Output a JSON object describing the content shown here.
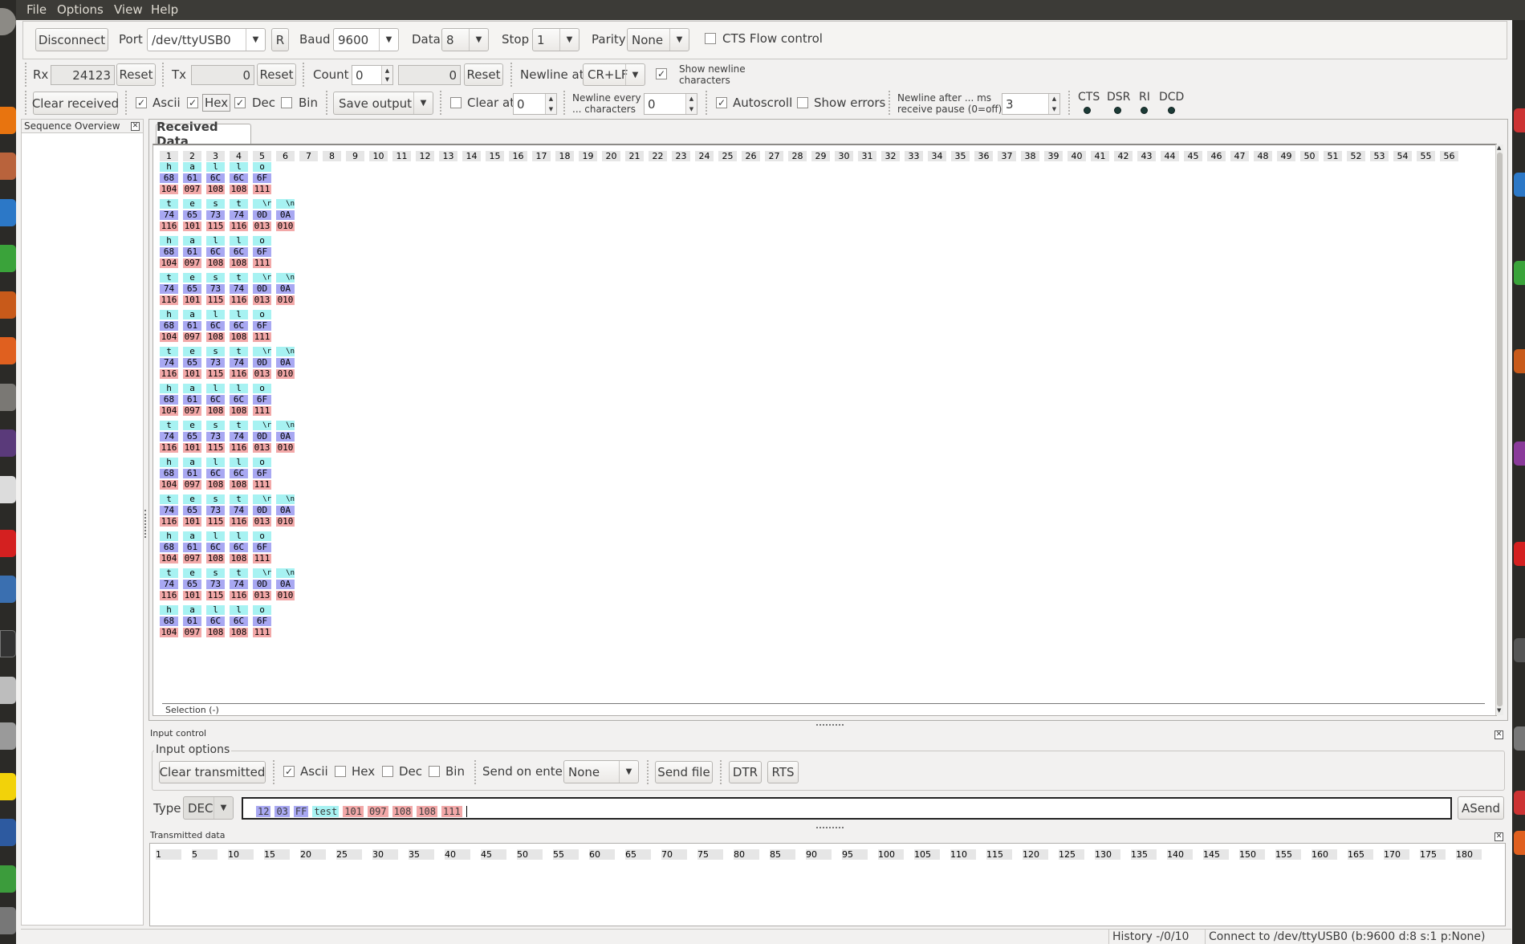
{
  "menu": [
    "File",
    "Options",
    "View",
    "Help"
  ],
  "connection": {
    "disconnect": "Disconnect",
    "port_label": "Port",
    "port_value": "/dev/ttyUSB0",
    "r_button": "R",
    "baud_label": "Baud",
    "baud_value": "9600",
    "data_label": "Data",
    "data_value": "8",
    "stop_label": "Stop",
    "stop_value": "1",
    "parity_label": "Parity",
    "parity_value": "None",
    "cts_flow": "CTS Flow control"
  },
  "counters": {
    "rx_label": "Rx",
    "rx_value": "24123",
    "reset1": "Reset",
    "tx_label": "Tx",
    "tx_value": "0",
    "reset2": "Reset",
    "count_label": "Count",
    "count_value": "0",
    "count_result": "0",
    "reset3": "Reset",
    "newline_at_label": "Newline at",
    "newline_at_value": "CR+LF",
    "show_newline_1": "Show newline",
    "show_newline_2": "characters"
  },
  "display": {
    "clear_received": "Clear received",
    "ascii": "Ascii",
    "hex": "Hex",
    "dec": "Dec",
    "bin": "Bin",
    "save_output": "Save output",
    "clear_at": "Clear at",
    "clear_at_value": "0",
    "newline_every_1": "Newline every",
    "newline_every_2": "... characters",
    "newline_every_value": "0",
    "autoscroll": "Autoscroll",
    "show_errors": "Show errors",
    "newline_after_1": "Newline after ... ms",
    "newline_after_2": "receive pause (0=off)",
    "newline_after_value": "3",
    "signals": [
      "CTS",
      "DSR",
      "RI",
      "DCD"
    ]
  },
  "sequence_overview": "Sequence Overview",
  "received": {
    "tab": "Received Data",
    "selection": "Selection (-)",
    "columns": [
      "1",
      "2",
      "3",
      "4",
      "5",
      "6",
      "7",
      "8",
      "9",
      "10",
      "11",
      "12",
      "13",
      "14",
      "15",
      "16",
      "17",
      "18",
      "19",
      "20",
      "21",
      "22",
      "23",
      "24",
      "25",
      "26",
      "27",
      "28",
      "29",
      "30",
      "31",
      "32",
      "33",
      "34",
      "35",
      "36",
      "37",
      "38",
      "39",
      "40",
      "41",
      "42",
      "43",
      "44",
      "45",
      "46",
      "47",
      "48",
      "49",
      "50",
      "51",
      "52",
      "53",
      "54",
      "55",
      "56"
    ],
    "rows": [
      {
        "ascii": [
          "h",
          "a",
          "l",
          "l",
          "o"
        ],
        "hex": [
          "68",
          "61",
          "6C",
          "6C",
          "6F"
        ],
        "dec": [
          "104",
          "097",
          "108",
          "108",
          "111"
        ]
      },
      {
        "ascii": [
          "t",
          "e",
          "s",
          "t",
          "\\r",
          "\\n"
        ],
        "hex": [
          "74",
          "65",
          "73",
          "74",
          "0D",
          "0A"
        ],
        "dec": [
          "116",
          "101",
          "115",
          "116",
          "013",
          "010"
        ]
      },
      {
        "ascii": [
          "h",
          "a",
          "l",
          "l",
          "o"
        ],
        "hex": [
          "68",
          "61",
          "6C",
          "6C",
          "6F"
        ],
        "dec": [
          "104",
          "097",
          "108",
          "108",
          "111"
        ]
      },
      {
        "ascii": [
          "t",
          "e",
          "s",
          "t",
          "\\r",
          "\\n"
        ],
        "hex": [
          "74",
          "65",
          "73",
          "74",
          "0D",
          "0A"
        ],
        "dec": [
          "116",
          "101",
          "115",
          "116",
          "013",
          "010"
        ]
      },
      {
        "ascii": [
          "h",
          "a",
          "l",
          "l",
          "o"
        ],
        "hex": [
          "68",
          "61",
          "6C",
          "6C",
          "6F"
        ],
        "dec": [
          "104",
          "097",
          "108",
          "108",
          "111"
        ]
      },
      {
        "ascii": [
          "t",
          "e",
          "s",
          "t",
          "\\r",
          "\\n"
        ],
        "hex": [
          "74",
          "65",
          "73",
          "74",
          "0D",
          "0A"
        ],
        "dec": [
          "116",
          "101",
          "115",
          "116",
          "013",
          "010"
        ]
      },
      {
        "ascii": [
          "h",
          "a",
          "l",
          "l",
          "o"
        ],
        "hex": [
          "68",
          "61",
          "6C",
          "6C",
          "6F"
        ],
        "dec": [
          "104",
          "097",
          "108",
          "108",
          "111"
        ]
      },
      {
        "ascii": [
          "t",
          "e",
          "s",
          "t",
          "\\r",
          "\\n"
        ],
        "hex": [
          "74",
          "65",
          "73",
          "74",
          "0D",
          "0A"
        ],
        "dec": [
          "116",
          "101",
          "115",
          "116",
          "013",
          "010"
        ]
      },
      {
        "ascii": [
          "h",
          "a",
          "l",
          "l",
          "o"
        ],
        "hex": [
          "68",
          "61",
          "6C",
          "6C",
          "6F"
        ],
        "dec": [
          "104",
          "097",
          "108",
          "108",
          "111"
        ]
      },
      {
        "ascii": [
          "t",
          "e",
          "s",
          "t",
          "\\r",
          "\\n"
        ],
        "hex": [
          "74",
          "65",
          "73",
          "74",
          "0D",
          "0A"
        ],
        "dec": [
          "116",
          "101",
          "115",
          "116",
          "013",
          "010"
        ]
      },
      {
        "ascii": [
          "h",
          "a",
          "l",
          "l",
          "o"
        ],
        "hex": [
          "68",
          "61",
          "6C",
          "6C",
          "6F"
        ],
        "dec": [
          "104",
          "097",
          "108",
          "108",
          "111"
        ]
      },
      {
        "ascii": [
          "t",
          "e",
          "s",
          "t",
          "\\r",
          "\\n"
        ],
        "hex": [
          "74",
          "65",
          "73",
          "74",
          "0D",
          "0A"
        ],
        "dec": [
          "116",
          "101",
          "115",
          "116",
          "013",
          "010"
        ]
      },
      {
        "ascii": [
          "h",
          "a",
          "l",
          "l",
          "o"
        ],
        "hex": [
          "68",
          "61",
          "6C",
          "6C",
          "6F"
        ],
        "dec": [
          "104",
          "097",
          "108",
          "108",
          "111"
        ]
      }
    ]
  },
  "input_control": {
    "title": "Input control",
    "options_title": "Input options",
    "clear_transmitted": "Clear transmitted",
    "ascii": "Ascii",
    "hex": "Hex",
    "dec": "Dec",
    "bin": "Bin",
    "send_on_enter_label": "Send on enter",
    "send_on_enter_value": "None",
    "send_file": "Send file",
    "dtr": "DTR",
    "rts": "RTS",
    "type_label": "Type",
    "type_value": "DEC",
    "input_segments": [
      {
        "text": "12",
        "kind": "hex"
      },
      {
        "text": "03",
        "kind": "hex"
      },
      {
        "text": "FF",
        "kind": "hex"
      },
      {
        "text": "test",
        "kind": "ascii"
      },
      {
        "text": "101",
        "kind": "dec"
      },
      {
        "text": "097",
        "kind": "dec"
      },
      {
        "text": "108",
        "kind": "dec"
      },
      {
        "text": "108",
        "kind": "dec"
      },
      {
        "text": "111",
        "kind": "dec"
      }
    ],
    "asend": "ASend"
  },
  "transmitted": {
    "title": "Transmitted data",
    "columns": [
      "1",
      "5",
      "10",
      "15",
      "20",
      "25",
      "30",
      "35",
      "40",
      "45",
      "50",
      "55",
      "60",
      "65",
      "70",
      "75",
      "80",
      "85",
      "90",
      "95",
      "100",
      "105",
      "110",
      "115",
      "120",
      "125",
      "130",
      "135",
      "140",
      "145",
      "150",
      "155",
      "160",
      "165",
      "170",
      "175",
      "180"
    ]
  },
  "status": {
    "history": "History -/0/10",
    "connection": "Connect to /dev/ttyUSB0 (b:9600 d:8 s:1 p:None)"
  },
  "colors": {
    "ascii_bg": "#a7f2f2",
    "hex_bg": "#a8a8f2",
    "dec_bg": "#f2a8a8",
    "menubar": "#3c3b37",
    "launcher": "#2b2a27"
  }
}
